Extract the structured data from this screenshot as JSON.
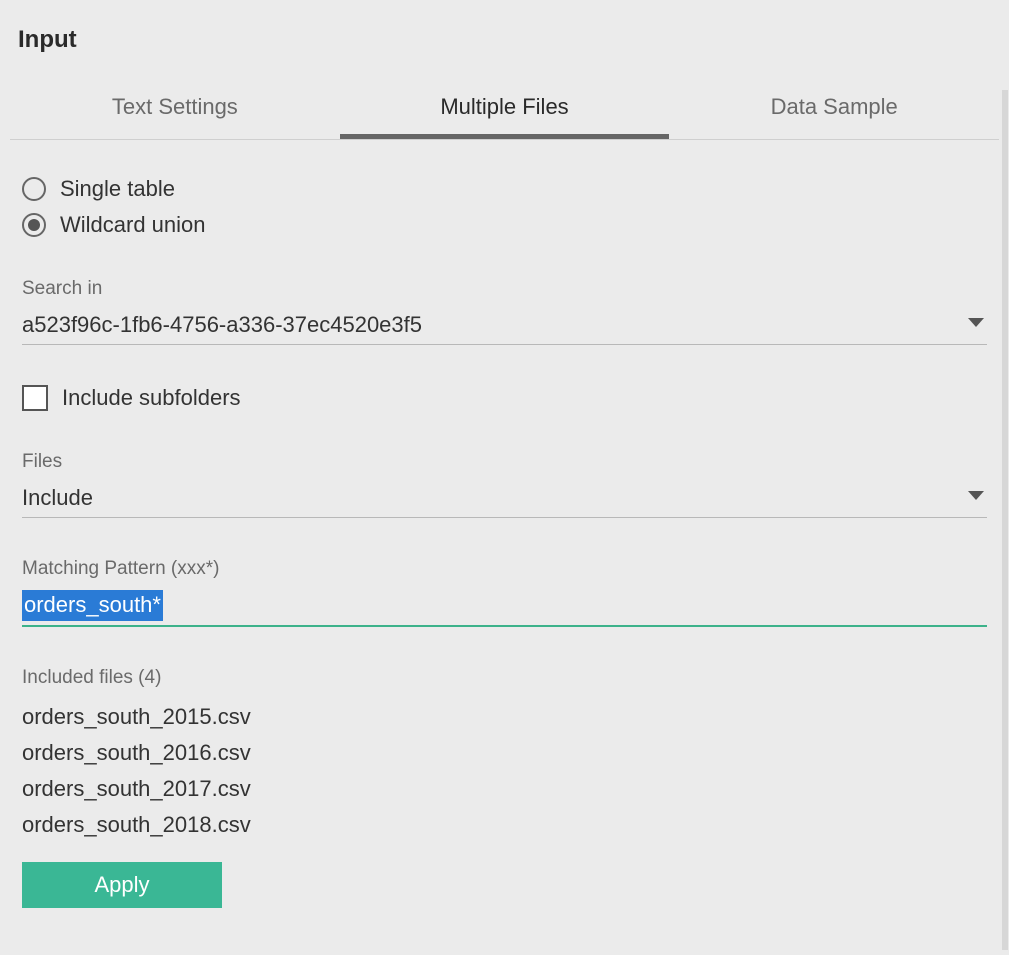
{
  "panel": {
    "title": "Input"
  },
  "tabs": [
    {
      "label": "Text Settings",
      "active": false
    },
    {
      "label": "Multiple Files",
      "active": true
    },
    {
      "label": "Data Sample",
      "active": false
    }
  ],
  "table_mode": {
    "options": [
      {
        "label": "Single table",
        "selected": false
      },
      {
        "label": "Wildcard union",
        "selected": true
      }
    ]
  },
  "search_in": {
    "label": "Search in",
    "value": "a523f96c-1fb6-4756-a336-37ec4520e3f5"
  },
  "include_subfolders": {
    "label": "Include subfolders",
    "checked": false
  },
  "files_filter": {
    "label": "Files",
    "value": "Include"
  },
  "matching_pattern": {
    "label": "Matching Pattern (xxx*)",
    "value": "orders_south*"
  },
  "included_files": {
    "label": "Included files (4)",
    "items": [
      "orders_south_2015.csv",
      "orders_south_2016.csv",
      "orders_south_2017.csv",
      "orders_south_2018.csv"
    ]
  },
  "apply": {
    "label": "Apply"
  }
}
